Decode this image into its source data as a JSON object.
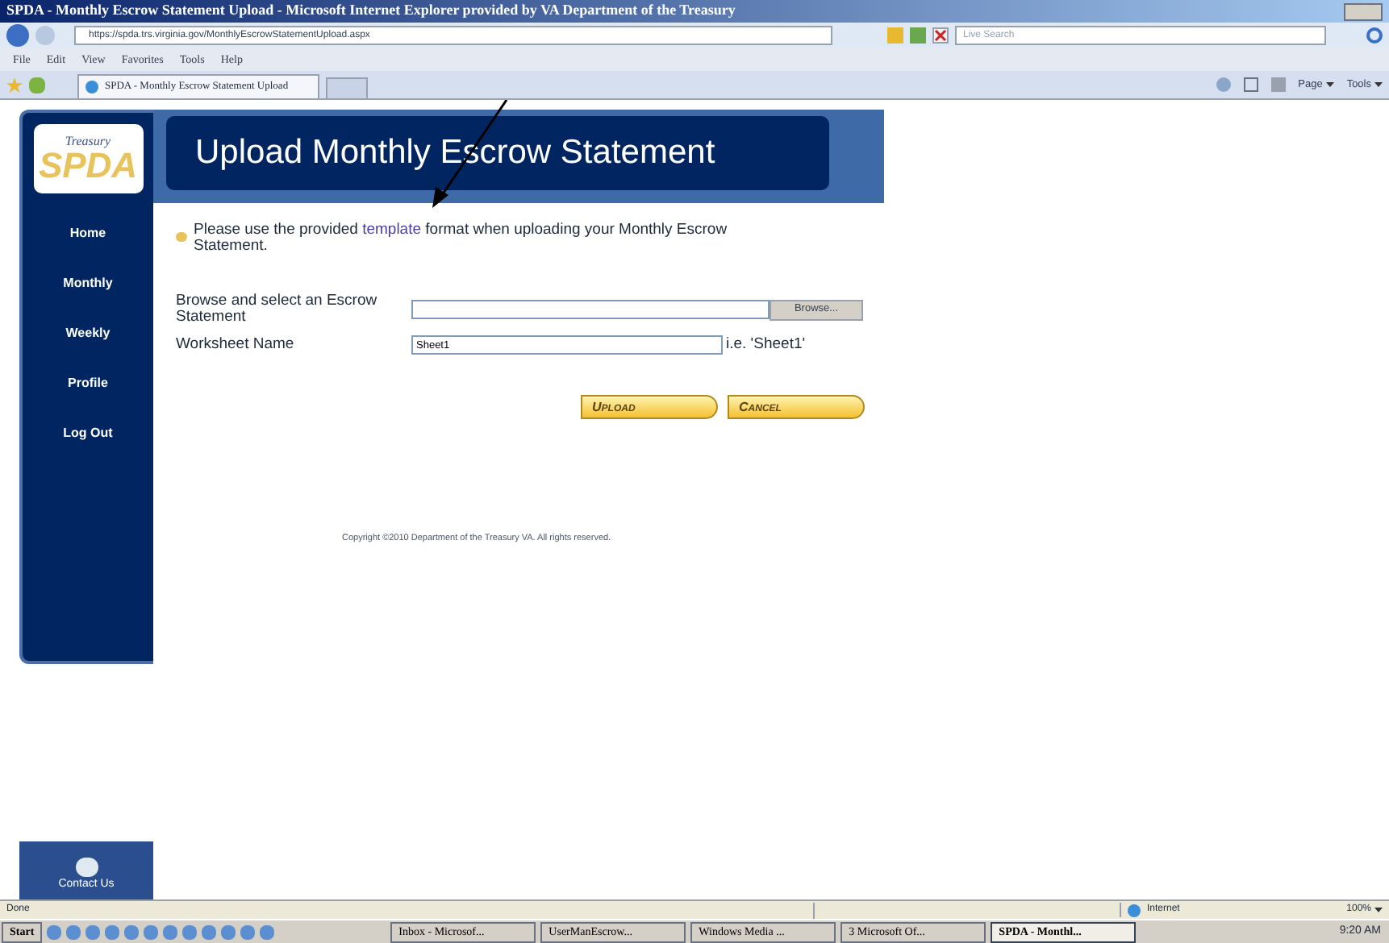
{
  "window": {
    "title": "SPDA - Monthly Escrow Statement Upload - Microsoft Internet Explorer provided by VA Department of the Treasury"
  },
  "address_bar": {
    "url": "https://spda.trs.virginia.gov/MonthlyEscrowStatementUpload.aspx",
    "search_placeholder": "Live Search"
  },
  "menu": [
    "File",
    "Edit",
    "View",
    "Favorites",
    "Tools",
    "Help"
  ],
  "tabs": [
    {
      "label": "SPDA - Monthly Escrow Statement Upload",
      "selected": true
    }
  ],
  "command_bar": [
    "Page",
    "Tools"
  ],
  "logo": {
    "top": "Treasury",
    "main": "SPDA"
  },
  "sidebar": {
    "items": [
      "Home",
      "Monthly",
      "Weekly",
      "Profile",
      "Log Out"
    ],
    "contact": "Contact Us"
  },
  "page_title": "Upload Monthly Escrow Statement",
  "notice": {
    "before": "Please use the provided",
    "link": "template",
    "after": "format when uploading your Monthly Escrow Statement."
  },
  "form": {
    "file_label": "Browse and select an Escrow Statement",
    "browse_button": "Browse...",
    "worksheet_label": "Worksheet Name",
    "worksheet_value": "Sheet1",
    "worksheet_hint": "i.e. 'Sheet1'"
  },
  "buttons": [
    "Upload",
    "Cancel"
  ],
  "copyright": "Copyright ©2010 Department of the Treasury VA. All rights reserved.",
  "status_bar": {
    "text": "Done",
    "zone": "Internet",
    "zoom": "100%"
  },
  "taskbar": {
    "start": "Start",
    "items": [
      {
        "label": "Inbox - Microsof...",
        "selected": false
      },
      {
        "label": "UserManEscrow...",
        "selected": false
      },
      {
        "label": "Windows Media ...",
        "selected": false
      },
      {
        "label": "3 Microsoft Of...",
        "selected": false
      },
      {
        "label": "SPDA - Monthl...",
        "selected": true
      }
    ],
    "clock": "9:20 AM"
  }
}
